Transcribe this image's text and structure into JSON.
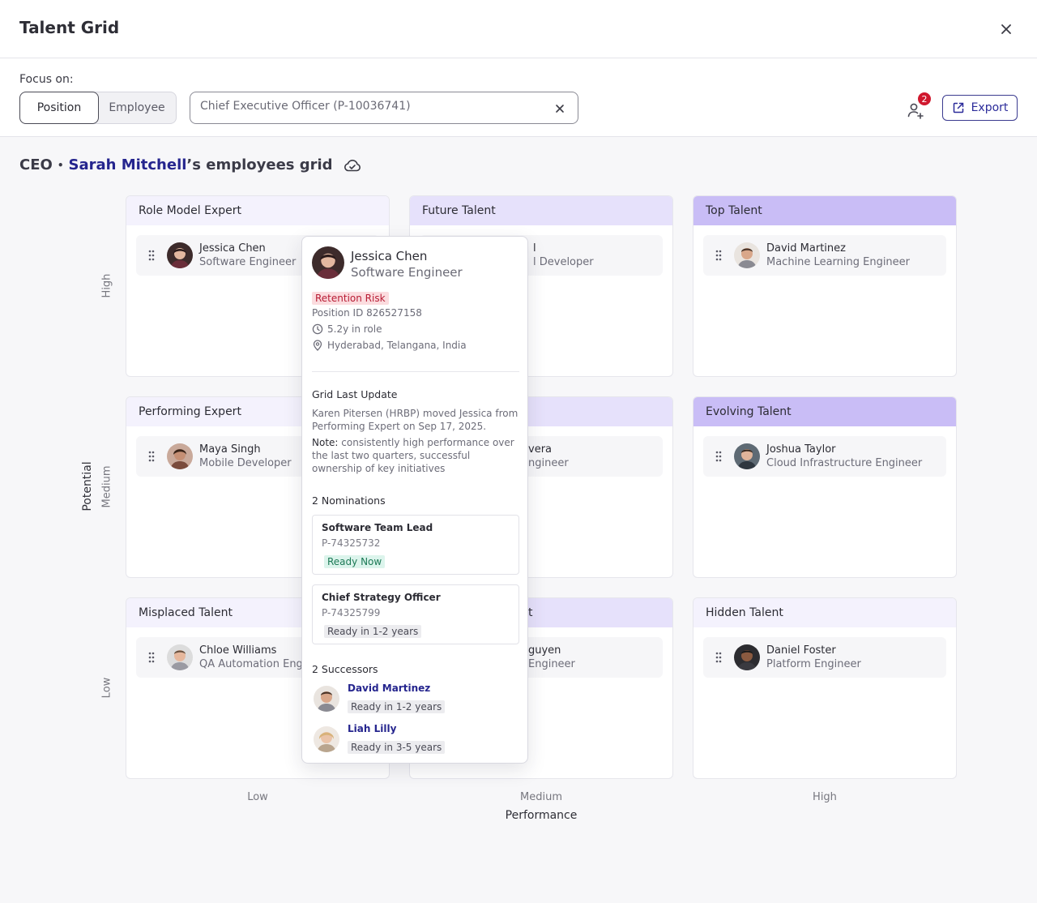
{
  "header": {
    "title": "Talent Grid"
  },
  "focus": {
    "label": "Focus on:",
    "options": [
      "Position",
      "Employee"
    ],
    "selected": "Position",
    "search_value": "Chief Executive Officer (P-10036741)",
    "notification_count": "2",
    "export_label": "Export"
  },
  "grid_title": {
    "role": "CEO",
    "separator": "•",
    "manager": "Sarah Mitchell",
    "suffix": "’s employees grid"
  },
  "cells": [
    {
      "title": "Role Model Expert",
      "employee": {
        "name": "Jessica Chen",
        "role": "Software Engineer"
      }
    },
    {
      "title": "Future Talent",
      "employee": {
        "name": "l",
        "role": "l Developer"
      }
    },
    {
      "title": "Top Talent",
      "employee": {
        "name": "David Martinez",
        "role": "Machine Learning Engineer"
      }
    },
    {
      "title": "Performing Expert",
      "employee": {
        "name": "Maya Singh",
        "role": "Mobile Developer"
      }
    },
    {
      "title": "",
      "employee": {
        "name": "vera",
        "role": "ngineer"
      }
    },
    {
      "title": "Evolving Talent",
      "employee": {
        "name": "Joshua Taylor",
        "role": "Cloud Infrastructure Engineer"
      }
    },
    {
      "title": "Misplaced Talent",
      "employee": {
        "name": "Chloe Williams",
        "role": "QA Automation Engi"
      }
    },
    {
      "title": "t",
      "employee": {
        "name": "guyen",
        "role": "Engineer"
      }
    },
    {
      "title": "Hidden Talent",
      "employee": {
        "name": "Daniel Foster",
        "role": "Platform Engineer"
      }
    }
  ],
  "axes": {
    "y_title": "Potential",
    "y_levels": [
      "High",
      "Medium",
      "Low"
    ],
    "x_title": "Performance",
    "x_levels": [
      "Low",
      "Medium",
      "High"
    ]
  },
  "popover": {
    "name": "Jessica Chen",
    "role": "Software Engineer",
    "risk": "Retention Risk",
    "position_id": "Position ID 826527158",
    "tenure": "5.2y in role",
    "location": "Hyderabad, Telangana, India",
    "update_title": "Grid Last Update",
    "update_text": "Karen Pitersen (HRBP) moved Jessica from Performing Expert on Sep 17, 2025.",
    "note_label": "Note:",
    "note_text": " consistently high performance over the last two quarters, successful ownership of key initiatives",
    "nominations_title": "2 Nominations",
    "nominations": [
      {
        "title": "Software Team Lead",
        "id": "P-74325732",
        "status": "Ready Now"
      },
      {
        "title": "Chief Strategy Officer",
        "id": "P-74325799",
        "status": "Ready in 1-2 years"
      }
    ],
    "successors_title": "2 Successors",
    "successors": [
      {
        "name": "David Martinez",
        "status": "Ready in 1-2 years"
      },
      {
        "name": "Liah Lilly",
        "status": "Ready in 3-5 years"
      }
    ]
  },
  "colors": {
    "accent": "#25258e",
    "risk": "#b81c34",
    "badge": "#d0182e",
    "ready": "#1d7a56"
  }
}
